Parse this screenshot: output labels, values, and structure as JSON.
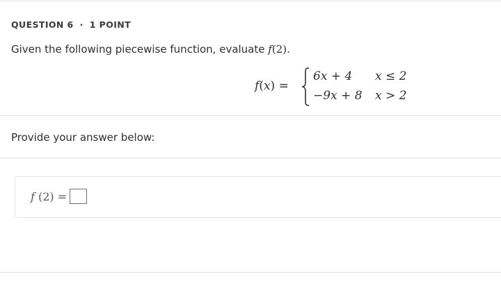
{
  "question": {
    "number_label": "QUESTION 6",
    "separator": "·",
    "points_label": "1 POINT",
    "prompt_text": "Given the following piecewise function, evaluate ",
    "prompt_math_f": "f",
    "prompt_math_arg": "(2)",
    "prompt_period": "."
  },
  "piecewise": {
    "lhs_f": "f",
    "lhs_open": "(",
    "lhs_var": "x",
    "lhs_close": ")",
    "equals": " = ",
    "cases": [
      {
        "expr": "6x + 4",
        "condition": "x ≤ 2"
      },
      {
        "expr": "−9x + 8",
        "condition": "x > 2"
      }
    ]
  },
  "answer": {
    "label": "Provide your answer below:",
    "expr_f": "f",
    "expr_arg": " (2) ",
    "expr_equals": "=",
    "input_value": ""
  },
  "colors": {
    "text": "#2d2f31",
    "rule": "#e3e3e3",
    "input_border": "#6f6f6f"
  }
}
